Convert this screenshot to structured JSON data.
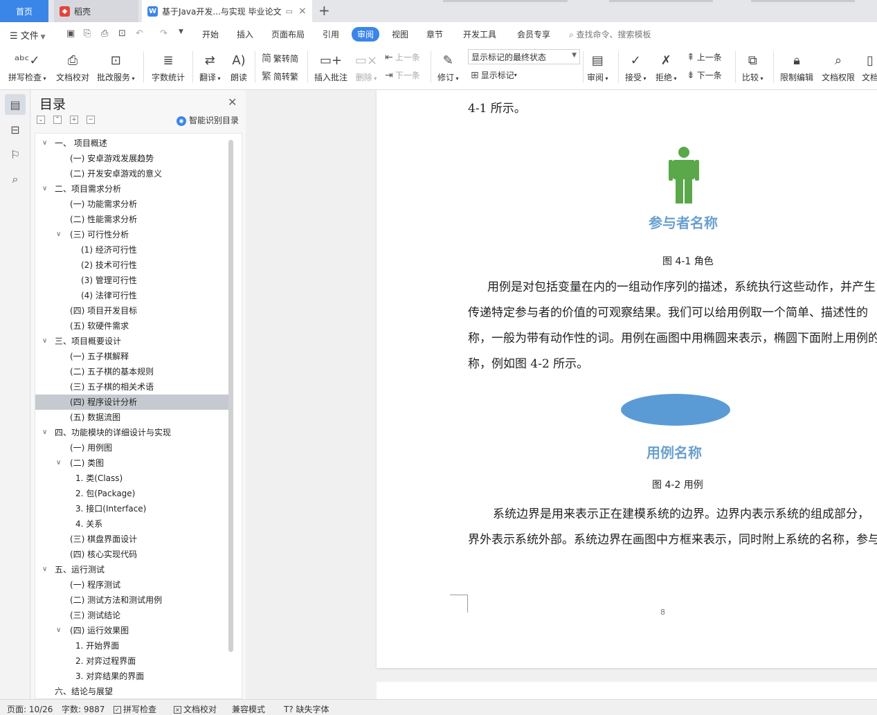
{
  "tabs": {
    "home": "首页",
    "daoke": "稻壳",
    "doc": "基于Java开发...与实现 毕业论文",
    "add": "+",
    "close": "×"
  },
  "menu": {
    "file": "文件",
    "items": [
      "开始",
      "插入",
      "页面布局",
      "引用",
      "审阅",
      "视图",
      "章节",
      "开发工具",
      "会员专享"
    ],
    "active": "审阅",
    "search_placeholder": "查找命令、搜索模板"
  },
  "toolbar": {
    "spell": "拼写检查",
    "proof": "文档校对",
    "annot_service": "批改服务",
    "wordcount": "字数统计",
    "translate": "翻译",
    "read_aloud": "朗读",
    "trad": "繁转简",
    "simp": "简转繁",
    "insert_comment": "插入批注",
    "delete": "删除",
    "prev": "上一条",
    "next": "下一条",
    "revise": "修订",
    "markup_state": "显示标记的最终状态",
    "show_markup": "显示标记",
    "review": "审阅",
    "accept": "接受",
    "reject": "拒绝",
    "prev2": "上一条",
    "next2": "下一条",
    "compare": "比较",
    "restrict": "限制编辑",
    "doc_rights": "文档权限",
    "doc_more": "文档"
  },
  "toc": {
    "title": "目录",
    "smart": "智能识别目录",
    "items": [
      {
        "text": "一、  项目概述",
        "level": 0,
        "caret": "open"
      },
      {
        "text": "(一) 安卓游戏发展趋势",
        "level": 1
      },
      {
        "text": "(二) 开发安卓游戏的意义",
        "level": 1
      },
      {
        "text": "二、项目需求分析",
        "level": 0,
        "caret": "open"
      },
      {
        "text": "(一) 功能需求分析",
        "level": 1
      },
      {
        "text": "(二) 性能需求分析",
        "level": 1
      },
      {
        "text": "(三) 可行性分析",
        "level": 1,
        "caret": "open"
      },
      {
        "text": "(1) 经济可行性",
        "level": 2
      },
      {
        "text": "(2) 技术可行性",
        "level": 2
      },
      {
        "text": "(3) 管理可行性",
        "level": 2
      },
      {
        "text": "(4) 法律可行性",
        "level": 2
      },
      {
        "text": "(四) 项目开发目标",
        "level": 1
      },
      {
        "text": "(五) 软硬件需求",
        "level": 1
      },
      {
        "text": "三、项目概要设计",
        "level": 0,
        "caret": "open"
      },
      {
        "text": "(一) 五子棋解释",
        "level": 1
      },
      {
        "text": "(二) 五子棋的基本规则",
        "level": 1
      },
      {
        "text": "(三) 五子棋的相关术语",
        "level": 1
      },
      {
        "text": "(四) 程序设计分析",
        "level": 1,
        "selected": true
      },
      {
        "text": "(五) 数据流图",
        "level": 1
      },
      {
        "text": "四、功能模块的详细设计与实现",
        "level": 0,
        "caret": "open"
      },
      {
        "text": "(一) 用例图",
        "level": 1
      },
      {
        "text": "(二) 类图",
        "level": 1,
        "caret": "open"
      },
      {
        "text": "1. 类(Class)",
        "level": 3
      },
      {
        "text": "2. 包(Package)",
        "level": 3
      },
      {
        "text": "3. 接口(Interface)",
        "level": 3
      },
      {
        "text": "4. 关系",
        "level": 3
      },
      {
        "text": "(三) 棋盘界面设计",
        "level": 1
      },
      {
        "text": "(四) 核心实现代码",
        "level": 1
      },
      {
        "text": "五、运行测试",
        "level": 0,
        "caret": "open"
      },
      {
        "text": "(一) 程序测试",
        "level": 1
      },
      {
        "text": "(二) 测试方法和测试用例",
        "level": 1
      },
      {
        "text": "(三) 测试结论",
        "level": 1
      },
      {
        "text": "(四) 运行效果图",
        "level": 1,
        "caret": "open"
      },
      {
        "text": "1. 开始界面",
        "level": 3
      },
      {
        "text": "2. 对弈过程界面",
        "level": 3
      },
      {
        "text": "3. 对弈结果的界面",
        "level": 3
      },
      {
        "text": "六、结论与展望",
        "level": 0
      }
    ]
  },
  "document": {
    "line0": "4-1 所示。",
    "fig1_label": "参与者名称",
    "fig1_caption": "图 4-1  角色",
    "para1": [
      "用例是对包括变量在内的一组动作序列的描述，系统执行这些动作，并产生",
      "传递特定参与者的价值的可观察结果。我们可以给用例取一个简单、描述性的",
      "称，一般为带有动作性的词。用例在画图中用椭圆来表示，椭圆下面附上用例的",
      "称，例如图 4-2 所示。"
    ],
    "fig2_label": "用例名称",
    "fig2_caption": "图 4-2  用例",
    "para2": [
      "系统边界是用来表示正在建模系统的边界。边界内表示系统的组成部分，",
      "界外表示系统外部。系统边界在画图中方框来表示，同时附上系统的名称，参与"
    ],
    "page_number": "8",
    "actor_color": "#5aa84a",
    "ellipse_color": "#5b9bd5"
  },
  "status": {
    "page": "页面: 10/26",
    "words": "字数: 9887",
    "spell": "拼写检查",
    "proof": "文档校对",
    "compat": "兼容模式",
    "missing_font": "缺失字体"
  }
}
